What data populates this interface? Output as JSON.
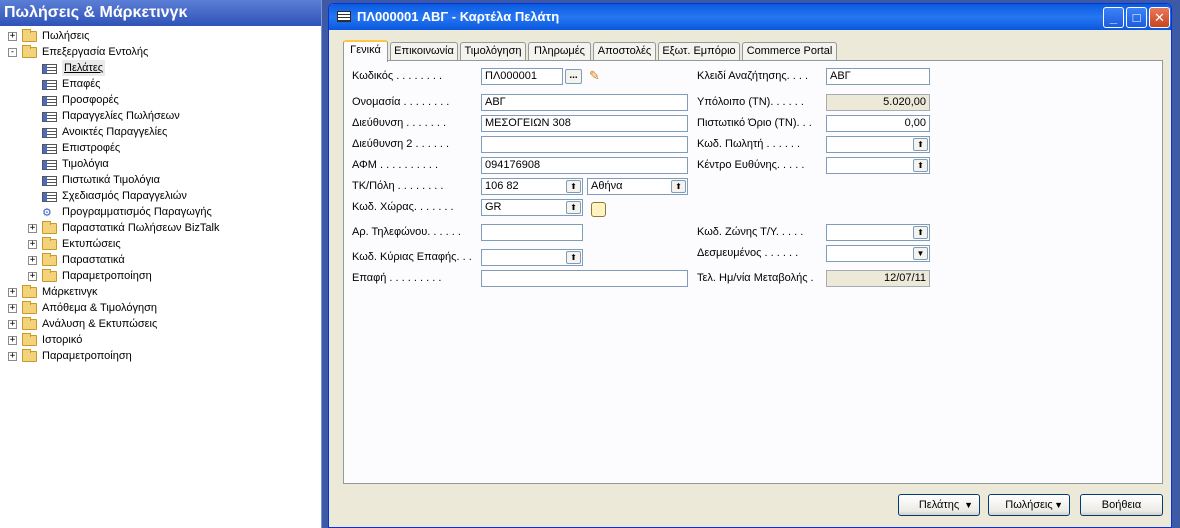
{
  "nav": {
    "title": "Πωλήσεις & Μάρκετινγκ",
    "items": [
      {
        "label": "Πωλήσεις",
        "level": 0,
        "icon": "folder",
        "expander": "+"
      },
      {
        "label": "Επεξεργασία Εντολής",
        "level": 0,
        "icon": "folder-open",
        "expander": "-"
      },
      {
        "label": "Πελάτες",
        "level": 1,
        "icon": "form",
        "expander": "",
        "selected": true
      },
      {
        "label": "Επαφές",
        "level": 1,
        "icon": "form",
        "expander": ""
      },
      {
        "label": "Προσφορές",
        "level": 1,
        "icon": "form",
        "expander": ""
      },
      {
        "label": "Παραγγελίες Πωλήσεων",
        "level": 1,
        "icon": "form",
        "expander": ""
      },
      {
        "label": "Ανοικτές Παραγγελίες",
        "level": 1,
        "icon": "form",
        "expander": ""
      },
      {
        "label": "Επιστροφές",
        "level": 1,
        "icon": "form",
        "expander": ""
      },
      {
        "label": "Τιμολόγια",
        "level": 1,
        "icon": "form",
        "expander": ""
      },
      {
        "label": "Πιστωτικά Τιμολόγια",
        "level": 1,
        "icon": "form",
        "expander": ""
      },
      {
        "label": "Σχεδιασμός Παραγγελιών",
        "level": 1,
        "icon": "form",
        "expander": ""
      },
      {
        "label": "Προγραμματισμός Παραγωγής",
        "level": 1,
        "icon": "planner",
        "expander": ""
      },
      {
        "label": "Παραστατικά Πωλήσεων BizTalk",
        "level": 1,
        "icon": "folder",
        "expander": "+"
      },
      {
        "label": "Εκτυπώσεις",
        "level": 1,
        "icon": "folder",
        "expander": "+"
      },
      {
        "label": "Παραστατικά",
        "level": 1,
        "icon": "folder",
        "expander": "+"
      },
      {
        "label": "Παραμετροποίηση",
        "level": 1,
        "icon": "folder",
        "expander": "+"
      },
      {
        "label": "Μάρκετινγκ",
        "level": 0,
        "icon": "folder",
        "expander": "+"
      },
      {
        "label": "Απόθεμα & Τιμολόγηση",
        "level": 0,
        "icon": "folder",
        "expander": "+"
      },
      {
        "label": "Ανάλυση & Εκτυπώσεις",
        "level": 0,
        "icon": "folder",
        "expander": "+"
      },
      {
        "label": "Ιστορικό",
        "level": 0,
        "icon": "folder",
        "expander": "+"
      },
      {
        "label": "Παραμετροποίηση",
        "level": 0,
        "icon": "folder",
        "expander": "+"
      }
    ]
  },
  "window": {
    "title": "ΠΛ000001 ΑΒΓ - Καρτέλα Πελάτη",
    "minimize": "_",
    "maximize": "□",
    "close": "✕"
  },
  "tabs": [
    "Γενικά",
    "Επικοινωνία",
    "Τιμολόγηση",
    "Πληρωμές",
    "Αποστολές",
    "Εξωτ. Εμπόριο",
    "Commerce Portal"
  ],
  "form": {
    "code_label": "Κωδικός . . . . . . . .",
    "code_value": "ΠΛ000001",
    "name_label": "Ονομασία . . . . . . . .",
    "name_value": "ΑΒΓ",
    "address_label": "Διεύθυνση . . . . . . .",
    "address_value": "ΜΕΣΟΓΕΙΩΝ 308",
    "address2_label": "Διεύθυνση 2 . . . . . .",
    "address2_value": "",
    "vat_label": "ΑΦΜ . . . . . . . . . .",
    "vat_value": "094176908",
    "postcode_label": "ΤΚ/Πόλη . . . . . . . .",
    "postcode_value": "106 82",
    "city_value": "Αθήνα",
    "country_label": "Κωδ. Χώρας. . . . . . .",
    "country_value": "GR",
    "phone_label": "Αρ. Τηλεφώνου. . . . . .",
    "phone_value": "",
    "primary_contact_label": "Κωδ. Κύριας Επαφής. . .",
    "primary_contact_value": "",
    "contact_label": "Επαφή . . . . . . . . .",
    "contact_value": "",
    "search_name_label": "Κλειδί Αναζήτησης. . . .",
    "search_name_value": "ΑΒΓ",
    "balance_label": "Υπόλοιπο (ΤΝ). . . . . .",
    "balance_value": "5.020,00",
    "credit_limit_label": "Πιστωτικό Όριο (ΤΝ). . .",
    "credit_limit_value": "0,00",
    "salesperson_label": "Κωδ. Πωλητή . . . . . .",
    "salesperson_value": "",
    "responsibility_label": "Κέντρο Ευθύνης. . . . .",
    "responsibility_value": "",
    "service_zone_label": "Κωδ. Ζώνης Τ/Υ. . . . .",
    "service_zone_value": "",
    "blocked_label": "Δεσμευμένος . . . . . .",
    "blocked_value": "",
    "last_modified_label": "Τελ. Ημ/νία Μεταβολής .",
    "last_modified_value": "12/07/11"
  },
  "buttons": {
    "customer": "Πελάτης",
    "sales": "Πωλήσεις",
    "help": "Βοήθεια"
  },
  "glyphs": {
    "lookup": "⬆",
    "dropdown": "▼",
    "ellipsis": "...",
    "pencil": "✎",
    "caret": "▼",
    "planner": "⚙"
  }
}
